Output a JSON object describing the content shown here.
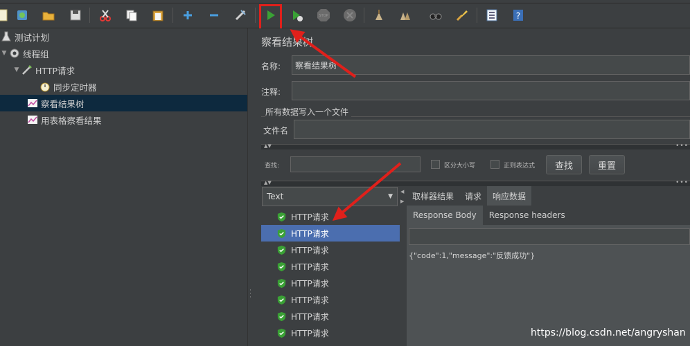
{
  "toolbar": {
    "buttons": [
      "new-icon",
      "templates-icon",
      "open-icon",
      "save-icon",
      "cut-icon",
      "copy-icon",
      "paste-icon",
      "expand-icon",
      "collapse-icon",
      "toggle-icon",
      "start-icon",
      "start-no-pauses-icon",
      "stop-icon",
      "shutdown-icon",
      "clear-icon",
      "clear-all-icon",
      "search-icon",
      "reset-search-icon",
      "function-helper-icon",
      "help-icon"
    ]
  },
  "tree": {
    "items": [
      {
        "label": "测试计划",
        "icon": "flask-icon",
        "level": 0
      },
      {
        "label": "线程组",
        "icon": "gear-icon",
        "level": 0
      },
      {
        "label": "HTTP请求",
        "icon": "pipette-icon",
        "level": 1
      },
      {
        "label": "同步定时器",
        "icon": "stopwatch-icon",
        "level": 2
      },
      {
        "label": "察看结果树",
        "icon": "chart-icon",
        "level": 1,
        "selected": true
      },
      {
        "label": "用表格察看结果",
        "icon": "chart-icon",
        "level": 1
      }
    ]
  },
  "panel": {
    "title": "察看结果树",
    "name_label": "名称:",
    "name_value": "察看结果树",
    "comment_label": "注释:",
    "comment_value": "",
    "file_group_label": "所有数据写入一个文件",
    "filename_label": "文件名",
    "filename_value": ""
  },
  "search": {
    "label": "查找:",
    "value": "",
    "case_sensitive_label": "区分大小写",
    "regex_label": "正则表达式",
    "find_button": "查找",
    "reset_button": "重置"
  },
  "results": {
    "renderer": "Text",
    "items": [
      "HTTP请求",
      "HTTP请求",
      "HTTP请求",
      "HTTP请求",
      "HTTP请求",
      "HTTP请求",
      "HTTP请求",
      "HTTP请求"
    ],
    "selected_index": 1
  },
  "tabs": {
    "main": [
      "取样器结果",
      "请求",
      "响应数据"
    ],
    "active_main": 2,
    "sub": [
      "Response Body",
      "Response headers"
    ],
    "active_sub": 0
  },
  "response": {
    "body": "{\"code\":1,\"message\":\"反馈成功\"}"
  },
  "watermark": "https://blog.csdn.net/angryshan",
  "colors": {
    "background": "#3c3f41",
    "selection": "#4b6eaf",
    "tree_selection": "#0d293e",
    "annotation_red": "#e0201b",
    "run_green": "#3aa135"
  }
}
